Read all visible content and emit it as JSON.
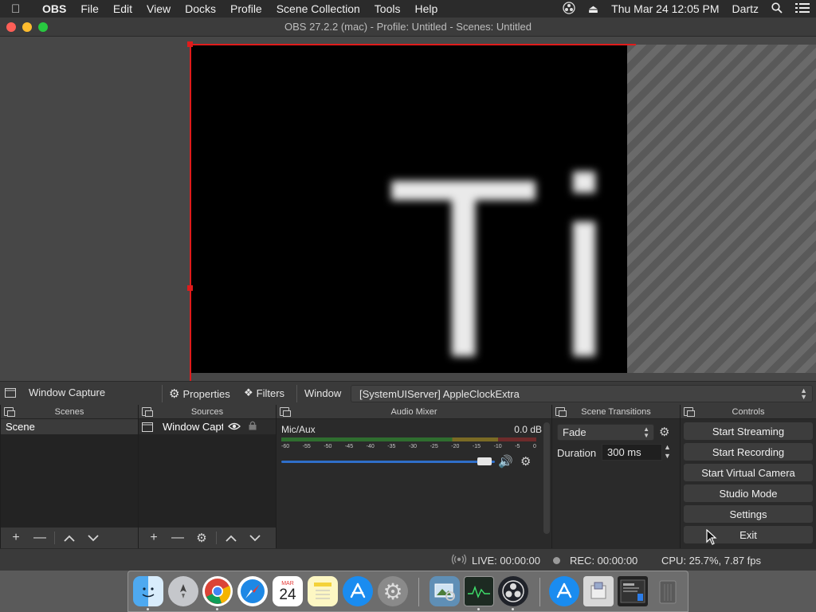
{
  "menubar": {
    "app_name": "OBS",
    "items": [
      "File",
      "Edit",
      "View",
      "Docks",
      "Profile",
      "Scene Collection",
      "Tools",
      "Help"
    ],
    "clock": "Thu Mar 24  12:05 PM",
    "user": "Dartz"
  },
  "window": {
    "title": "OBS 27.2.2 (mac) - Profile: Untitled - Scenes: Untitled"
  },
  "preview": {
    "captured_text": "Ti"
  },
  "context_bar": {
    "source_name": "Window Capture",
    "properties_label": "Properties",
    "filters_label": "Filters",
    "window_label": "Window",
    "window_value": "[SystemUIServer] AppleClockExtra"
  },
  "docks": {
    "scenes": {
      "title": "Scenes",
      "items": [
        "Scene"
      ]
    },
    "sources": {
      "title": "Sources",
      "items": [
        "Window Capture"
      ]
    },
    "mixer": {
      "title": "Audio Mixer",
      "channel_name": "Mic/Aux",
      "channel_db": "0.0 dB",
      "ticks": [
        "-60",
        "-55",
        "-50",
        "-45",
        "-40",
        "-35",
        "-30",
        "-25",
        "-20",
        "-15",
        "-10",
        "-5",
        "0"
      ],
      "volume_level": 0.95
    },
    "transitions": {
      "title": "Scene Transitions",
      "selected": "Fade",
      "duration_label": "Duration",
      "duration_value": "300 ms"
    },
    "controls": {
      "title": "Controls",
      "buttons": [
        "Start Streaming",
        "Start Recording",
        "Start Virtual Camera",
        "Studio Mode",
        "Settings",
        "Exit"
      ]
    }
  },
  "statusbar": {
    "live": "LIVE: 00:00:00",
    "rec": "REC: 00:00:00",
    "cpu": "CPU: 25.7%, 7.87 fps"
  },
  "dock_apps": [
    "finder",
    "launchpad",
    "chrome",
    "safari",
    "calendar",
    "notes",
    "app-store",
    "system-preferences",
    "preview",
    "activity-monitor",
    "obs",
    "app-store-2",
    "file-manager",
    "screenshot-window",
    "trash"
  ],
  "calendar_icon": {
    "month": "MAR",
    "day": "24"
  },
  "colors": {
    "selection_red": "#e01b1b",
    "meter_green": "#2f6d2f",
    "volume_blue": "#2f6fc9"
  }
}
